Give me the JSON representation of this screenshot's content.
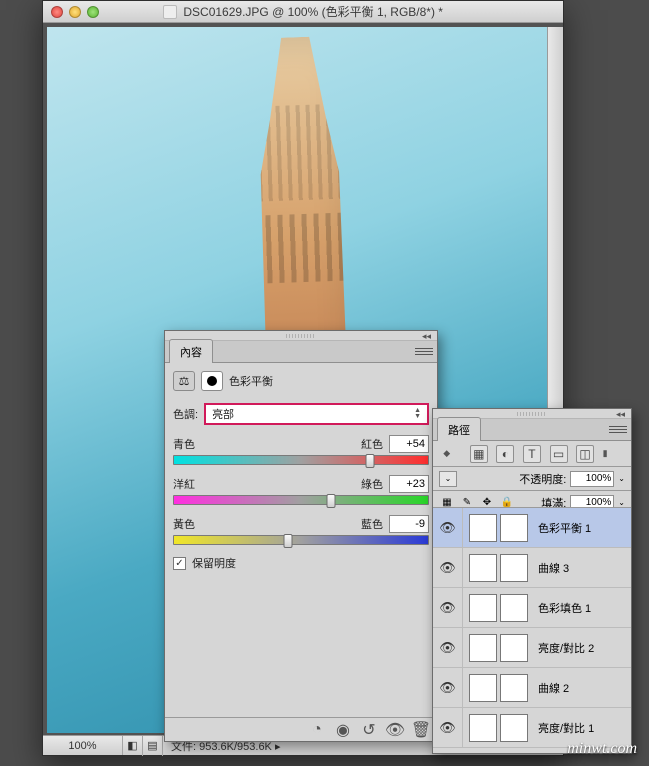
{
  "document": {
    "title": "DSC01629.JPG @ 100% (色彩平衡 1, RGB/8*) *",
    "zoom": "100%",
    "status": "文件: 953.6K/953.6K"
  },
  "props_panel": {
    "tab": "內容",
    "adjustment_name": "色彩平衡",
    "tone_label": "色調:",
    "tone_value": "亮部",
    "sliders": [
      {
        "left": "青色",
        "right": "紅色",
        "value": "+54",
        "pct": 77
      },
      {
        "left": "洋紅",
        "right": "綠色",
        "value": "+23",
        "pct": 62
      },
      {
        "left": "黃色",
        "right": "藍色",
        "value": "-9",
        "pct": 45
      }
    ],
    "preserve_lum_label": "保留明度",
    "preserve_lum_checked": true
  },
  "layers_panel": {
    "tab": "路徑",
    "opacity_label": "不透明度:",
    "opacity_value": "100%",
    "fill_label": "填滿:",
    "fill_value": "100%",
    "layers": [
      {
        "name": "色彩平衡 1",
        "selected": true
      },
      {
        "name": "曲線 3",
        "selected": false
      },
      {
        "name": "色彩填色 1",
        "selected": false
      },
      {
        "name": "亮度/對比 2",
        "selected": false
      },
      {
        "name": "曲線 2",
        "selected": false
      },
      {
        "name": "亮度/對比 1",
        "selected": false
      }
    ]
  },
  "watermark": "minwt.com"
}
